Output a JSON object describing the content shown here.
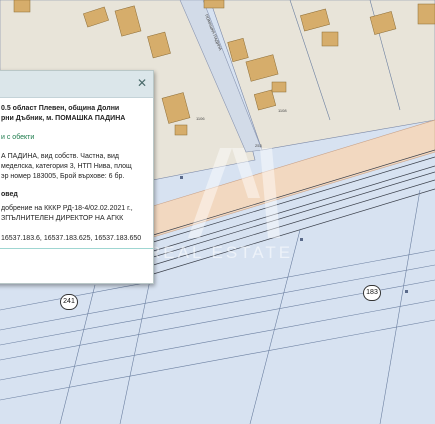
{
  "popup": {
    "close_label": "✕",
    "address": "0.5 област Плевен, община Долни\nрни Дъбник, м. ПОМАШКА ПАДИНА",
    "link_text": "и с обекти",
    "description": "А ПАДИНА, вид собств. Частна, вид\nмеделска, категория 3, НТП Нива, площ\nэр номер 183005, Брой върхове: 6 бр.",
    "section_title": "овед",
    "section_text": "добрение на КККР РД-18-4/02.02.2021 г.,\nЗПЪЛНИТЕЛЕН ДИРЕКТОР НА АГКК",
    "coordinates": "16537.183.6, 16537.183.625, 16537.183.650"
  },
  "map": {
    "plot_labels": [
      "241",
      "183"
    ],
    "street_label": "ПОМАШКА ПАДИНА",
    "small_labels": [
      "1106",
      "1108",
      "253"
    ]
  },
  "watermark": {
    "text": "REAL ESTATE"
  },
  "colors": {
    "background": "#d7e2f1",
    "parcel_fill": "#e9e4d6",
    "building": "#d6ad6b",
    "road": "#f6d9bf",
    "parcel_line": "#6b7fa0"
  }
}
